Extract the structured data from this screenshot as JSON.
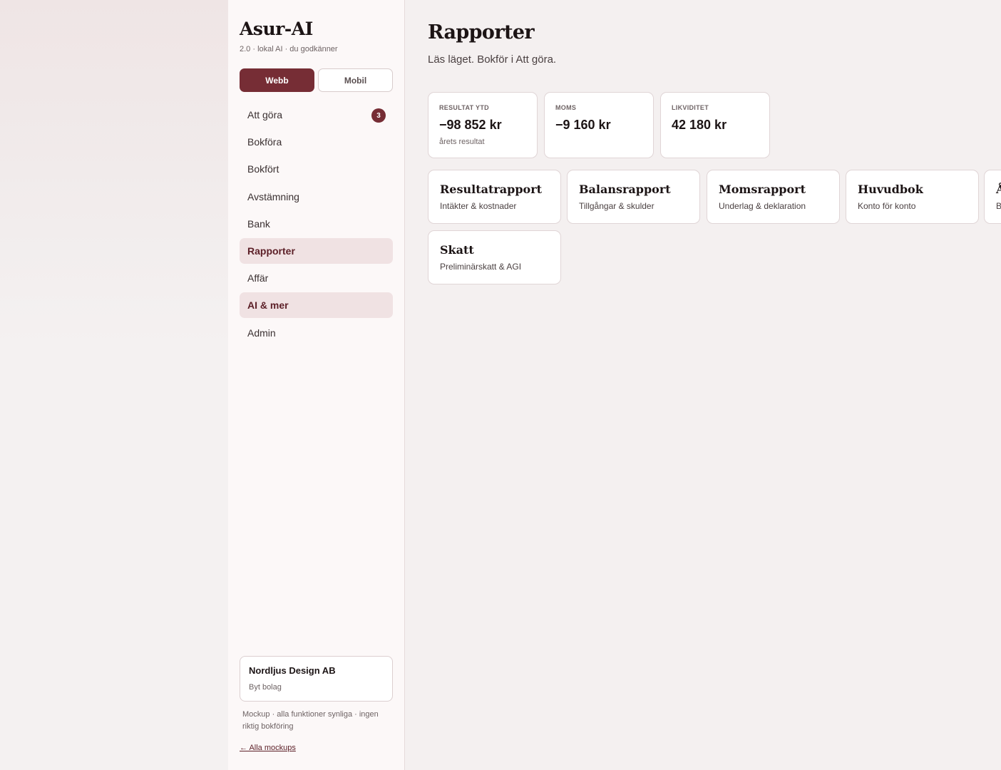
{
  "app": {
    "title": "Asur-AI",
    "subtitle": "2.0 · lokal AI · du godkänner"
  },
  "mode_toggle": {
    "web": "Webb",
    "mobile": "Mobil",
    "selected": "Webb"
  },
  "nav": {
    "items": [
      {
        "label": "Att göra",
        "badge": "3",
        "active": false
      },
      {
        "label": "Bokföra",
        "active": false
      },
      {
        "label": "Bokfört",
        "active": false
      },
      {
        "label": "Avstämning",
        "active": false
      },
      {
        "label": "Bank",
        "active": false
      },
      {
        "label": "Rapporter",
        "active": true
      },
      {
        "label": "Affär",
        "active": false
      },
      {
        "label": "AI & mer",
        "active": true
      },
      {
        "label": "Admin",
        "active": false
      }
    ]
  },
  "company": {
    "name": "Nordljus Design AB",
    "switch_label": "Byt bolag"
  },
  "footnote": "Mockup · alla funktioner synliga · ingen riktig bokföring",
  "back_link": "← Alla mockups",
  "page": {
    "title": "Rapporter",
    "subtitle": "Läs läget. Bokför i Att göra."
  },
  "kpis": [
    {
      "label": "RESULTAT YTD",
      "value": "−98 852 kr",
      "note": "årets resultat"
    },
    {
      "label": "MOMS",
      "value": "−9 160 kr",
      "note": ""
    },
    {
      "label": "LIKVIDITET",
      "value": "42 180 kr",
      "note": ""
    }
  ],
  "reports": [
    {
      "title": "Resultatrapport",
      "desc": "Intäkter & kostnader"
    },
    {
      "title": "Balansrapport",
      "desc": "Tillgångar & skulder"
    },
    {
      "title": "Momsrapport",
      "desc": "Underlag & deklaration"
    },
    {
      "title": "Huvudbok",
      "desc": "Konto för konto"
    },
    {
      "title": "Å",
      "desc": "B"
    },
    {
      "title": "Skatt",
      "desc": "Preliminärskatt & AGI"
    }
  ],
  "colors": {
    "accent": "#762d35",
    "active_bg": "#f0e2e3",
    "sidebar_bg": "#fcf8f8",
    "main_bg": "#f4f0f0"
  }
}
